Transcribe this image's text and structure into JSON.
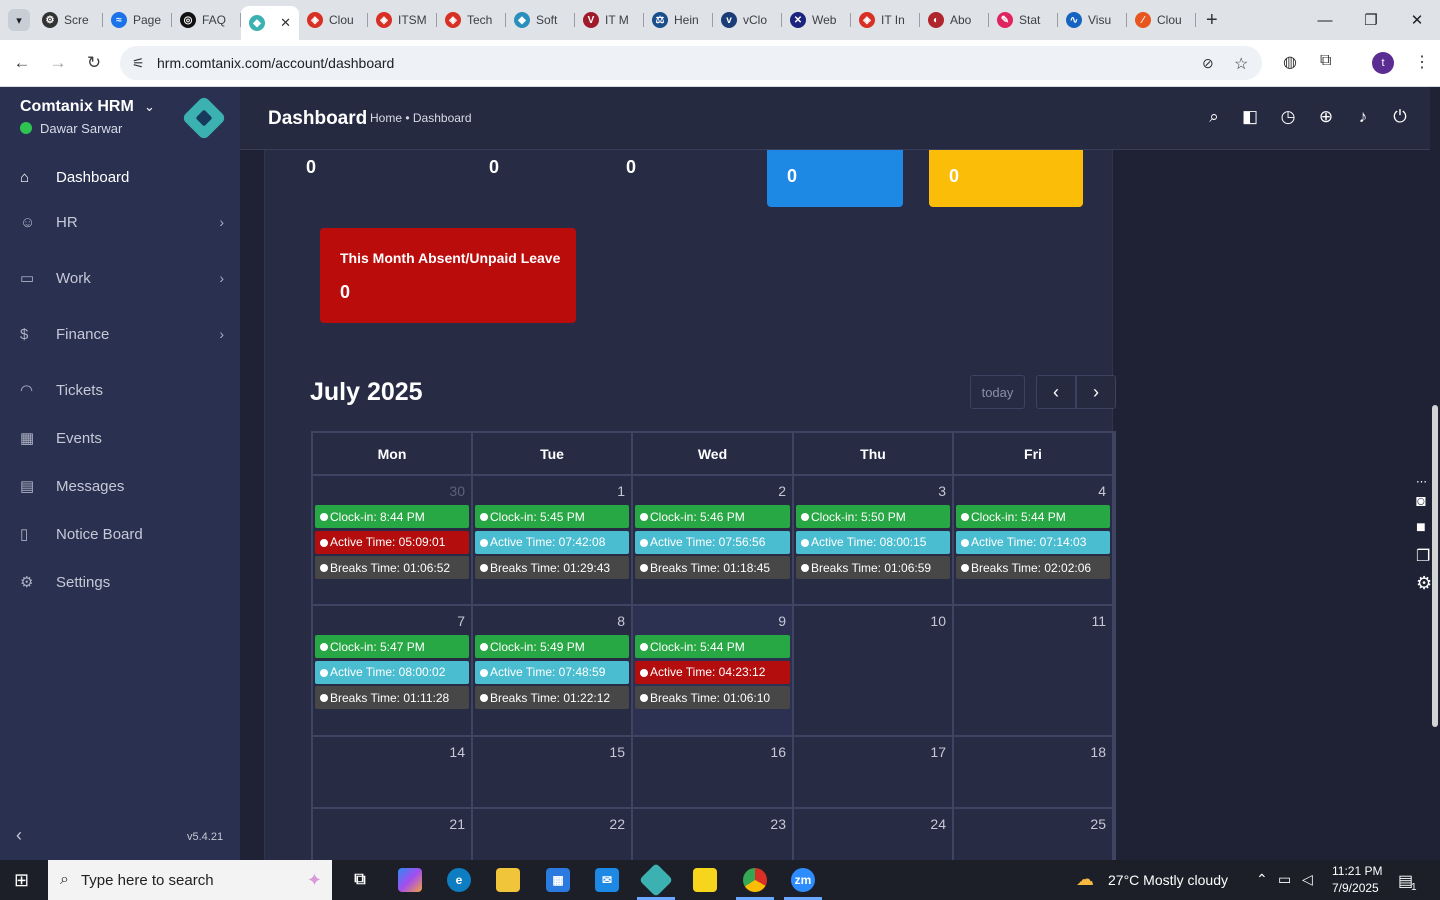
{
  "browser": {
    "tabs": [
      {
        "title": "Scre",
        "color": "#333333",
        "glyph": "⚙"
      },
      {
        "title": "Page",
        "color": "#1a73e8",
        "glyph": "≈"
      },
      {
        "title": "FAQ",
        "color": "#111111",
        "glyph": "◎"
      },
      {
        "title": "",
        "color": "#3bb1b1",
        "glyph": "◆",
        "active": true
      },
      {
        "title": "Clou",
        "color": "#d93025",
        "glyph": "◈"
      },
      {
        "title": "ITSM",
        "color": "#d93025",
        "glyph": "◈"
      },
      {
        "title": "Tech",
        "color": "#d93025",
        "glyph": "◈"
      },
      {
        "title": "Soft",
        "color": "#2a8fbd",
        "glyph": "◆"
      },
      {
        "title": "IT M",
        "color": "#a01a2a",
        "glyph": "V"
      },
      {
        "title": "Hein",
        "color": "#1a4f8a",
        "glyph": "⚖"
      },
      {
        "title": "vClo",
        "color": "#1a3d7a",
        "glyph": "v"
      },
      {
        "title": "Web",
        "color": "#1a237e",
        "glyph": "✕"
      },
      {
        "title": "IT In",
        "color": "#d93025",
        "glyph": "◈"
      },
      {
        "title": "Abo",
        "color": "#b0252c",
        "glyph": "◐"
      },
      {
        "title": "Stat",
        "color": "#e0245e",
        "glyph": "✎"
      },
      {
        "title": "Visu",
        "color": "#1565c0",
        "glyph": "∿"
      },
      {
        "title": "Clou",
        "color": "#e8551f",
        "glyph": "∕"
      }
    ],
    "url": "hrm.comtanix.com/account/dashboard",
    "profile_initial": "t"
  },
  "sidebar": {
    "brand": "Comtanix HRM",
    "user": "Dawar Sarwar",
    "version": "v5.4.21",
    "items": [
      {
        "label": "Dashboard",
        "icon": "home-icon",
        "glyph": "⌂",
        "active": true,
        "chevron": false
      },
      {
        "label": "HR",
        "icon": "users-icon",
        "glyph": "☺",
        "chevron": true
      },
      {
        "label": "Work",
        "icon": "briefcase-icon",
        "glyph": "▭",
        "chevron": true
      },
      {
        "label": "Finance",
        "icon": "dollar-icon",
        "glyph": "$",
        "chevron": true
      },
      {
        "label": "Tickets",
        "icon": "headset-icon",
        "glyph": "◠",
        "chevron": false
      },
      {
        "label": "Events",
        "icon": "calendar-icon",
        "glyph": "▦",
        "chevron": false
      },
      {
        "label": "Messages",
        "icon": "message-icon",
        "glyph": "▤",
        "chevron": false
      },
      {
        "label": "Notice Board",
        "icon": "clipboard-icon",
        "glyph": "▯",
        "chevron": false
      },
      {
        "label": "Settings",
        "icon": "gear-icon",
        "glyph": "⚙",
        "chevron": false
      }
    ]
  },
  "header": {
    "title": "Dashboard",
    "breadcrumb": "Home • Dashboard"
  },
  "stats": {
    "counts": [
      "0",
      "0",
      "0"
    ],
    "blue_card_value": "0",
    "blue_card_color": "#1e88e5",
    "yellow_card_value": "0",
    "yellow_card_color": "#fbbd08",
    "absent_title": "This Month Absent/Unpaid Leave",
    "absent_value": "0",
    "absent_color": "#bb0c0c"
  },
  "calendar": {
    "title": "July 2025",
    "today_label": "today",
    "days": [
      "Mon",
      "Tue",
      "Wed",
      "Thu",
      "Fri"
    ],
    "weeks": [
      [
        {
          "day": "30",
          "other": true,
          "events": [
            {
              "t": "Clock-in: 8:44 PM",
              "c": "green"
            },
            {
              "t": "Active Time: 05:09:01",
              "c": "red"
            },
            {
              "t": "Breaks Time: 01:06:52",
              "c": "dark"
            }
          ]
        },
        {
          "day": "1",
          "events": [
            {
              "t": "Clock-in: 5:45 PM",
              "c": "green"
            },
            {
              "t": "Active Time: 07:42:08",
              "c": "teal"
            },
            {
              "t": "Breaks Time: 01:29:43",
              "c": "dark"
            }
          ]
        },
        {
          "day": "2",
          "events": [
            {
              "t": "Clock-in: 5:46 PM",
              "c": "green"
            },
            {
              "t": "Active Time: 07:56:56",
              "c": "teal"
            },
            {
              "t": "Breaks Time: 01:18:45",
              "c": "dark"
            }
          ]
        },
        {
          "day": "3",
          "events": [
            {
              "t": "Clock-in: 5:50 PM",
              "c": "green"
            },
            {
              "t": "Active Time: 08:00:15",
              "c": "teal"
            },
            {
              "t": "Breaks Time: 01:06:59",
              "c": "dark"
            }
          ]
        },
        {
          "day": "4",
          "events": [
            {
              "t": "Clock-in: 5:44 PM",
              "c": "green"
            },
            {
              "t": "Active Time: 07:14:03",
              "c": "teal"
            },
            {
              "t": "Breaks Time: 02:02:06",
              "c": "dark"
            }
          ]
        }
      ],
      [
        {
          "day": "7",
          "events": [
            {
              "t": "Clock-in: 5:47 PM",
              "c": "green"
            },
            {
              "t": "Active Time: 08:00:02",
              "c": "teal"
            },
            {
              "t": "Breaks Time: 01:11:28",
              "c": "dark"
            }
          ]
        },
        {
          "day": "8",
          "events": [
            {
              "t": "Clock-in: 5:49 PM",
              "c": "green"
            },
            {
              "t": "Active Time: 07:48:59",
              "c": "teal"
            },
            {
              "t": "Breaks Time: 01:22:12",
              "c": "dark"
            }
          ]
        },
        {
          "day": "9",
          "today": true,
          "events": [
            {
              "t": "Clock-in: 5:44 PM",
              "c": "green"
            },
            {
              "t": "Active Time: 04:23:12",
              "c": "red"
            },
            {
              "t": "Breaks Time: 01:06:10",
              "c": "dark"
            }
          ]
        },
        {
          "day": "10",
          "events": []
        },
        {
          "day": "11",
          "events": []
        }
      ],
      [
        {
          "day": "14",
          "events": []
        },
        {
          "day": "15",
          "events": []
        },
        {
          "day": "16",
          "events": []
        },
        {
          "day": "17",
          "events": []
        },
        {
          "day": "18",
          "events": []
        }
      ],
      [
        {
          "day": "21",
          "events": []
        },
        {
          "day": "22",
          "events": []
        },
        {
          "day": "23",
          "events": []
        },
        {
          "day": "24",
          "events": []
        },
        {
          "day": "25",
          "events": []
        }
      ]
    ]
  },
  "taskbar": {
    "search_placeholder": "Type here to search",
    "weather": "27°C  Mostly cloudy",
    "time": "11:21 PM",
    "date": "7/9/2025",
    "notification_count": "1"
  }
}
